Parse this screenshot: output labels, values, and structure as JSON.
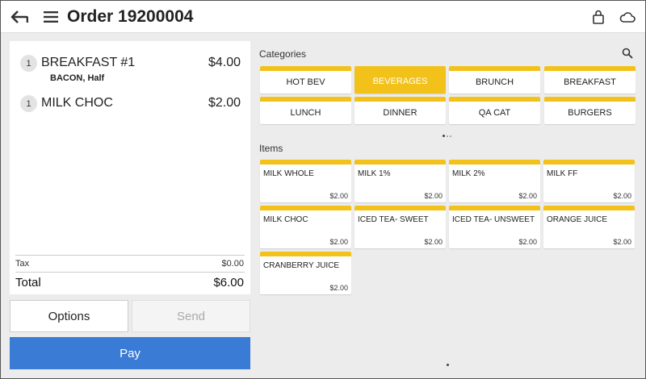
{
  "header": {
    "title": "Order 19200004",
    "back_icon": "back-arrow-icon",
    "menu_icon": "hamburger-menu-icon",
    "lock_icon": "lock-icon",
    "cloud_icon": "cloud-icon"
  },
  "order": {
    "lines": [
      {
        "qty": "1",
        "name": "BREAKFAST #1",
        "price": "$4.00",
        "modifier": "BACON, Half"
      },
      {
        "qty": "1",
        "name": "MILK CHOC",
        "price": "$2.00",
        "modifier": ""
      }
    ],
    "tax_label": "Tax",
    "tax_value": "$0.00",
    "total_label": "Total",
    "total_value": "$6.00"
  },
  "buttons": {
    "options": "Options",
    "send": "Send",
    "pay": "Pay"
  },
  "categories": {
    "label": "Categories",
    "selected": "BEVERAGES",
    "items": [
      "HOT BEV",
      "BEVERAGES",
      "BRUNCH",
      "BREAKFAST",
      "LUNCH",
      "DINNER",
      "QA CAT",
      "BURGERS"
    ]
  },
  "items": {
    "label": "Items",
    "list": [
      {
        "name": "MILK WHOLE",
        "price": "$2.00"
      },
      {
        "name": "MILK 1%",
        "price": "$2.00"
      },
      {
        "name": "MILK 2%",
        "price": "$2.00"
      },
      {
        "name": "MILK FF",
        "price": "$2.00"
      },
      {
        "name": "MILK CHOC",
        "price": "$2.00"
      },
      {
        "name": "ICED TEA- SWEET",
        "price": "$2.00"
      },
      {
        "name": "ICED TEA- UNSWEET",
        "price": "$2.00"
      },
      {
        "name": "ORANGE JUICE",
        "price": "$2.00"
      },
      {
        "name": "CRANBERRY JUICE",
        "price": "$2.00"
      }
    ]
  },
  "colors": {
    "accent": "#f2c21b",
    "pay": "#3a7bd5"
  }
}
